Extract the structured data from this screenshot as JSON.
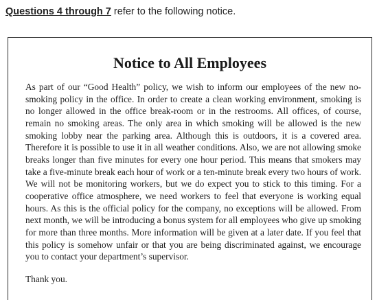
{
  "instruction": {
    "reference": "Questions 4 through 7",
    "text": " refer to the following notice."
  },
  "notice": {
    "title": "Notice to All Employees",
    "body": "As part of our “Good Health” policy, we wish to inform our employees of the new no-smoking policy in the office. In order to create a clean working environment, smoking is no longer allowed in the office break-room or in the restrooms. All offices, of course, remain no smoking areas. The only area in which smoking will be allowed is the new smoking lobby near the parking area. Although this is outdoors, it is a covered area. Therefore it is possible to use it in all weather conditions. Also, we are not allowing smoke breaks longer than five minutes for every one hour period. This means that smokers may take a five-minute break each hour of work or a ten-minute break every two hours of work. We will not be monitoring workers, but we do expect you to stick to this timing. For a cooperative office atmosphere, we need workers to feel that everyone is working equal hours. As this is the official policy for the company, no exceptions will be allowed. From next month, we will be introducing a bonus system for all employees who give up smoking for more than three months. More information will be given at a later date. If you feel that this policy is somehow unfair or that you are being discriminated against, we encourage you to contact your department’s supervisor.",
    "signoff": "Thank you."
  }
}
